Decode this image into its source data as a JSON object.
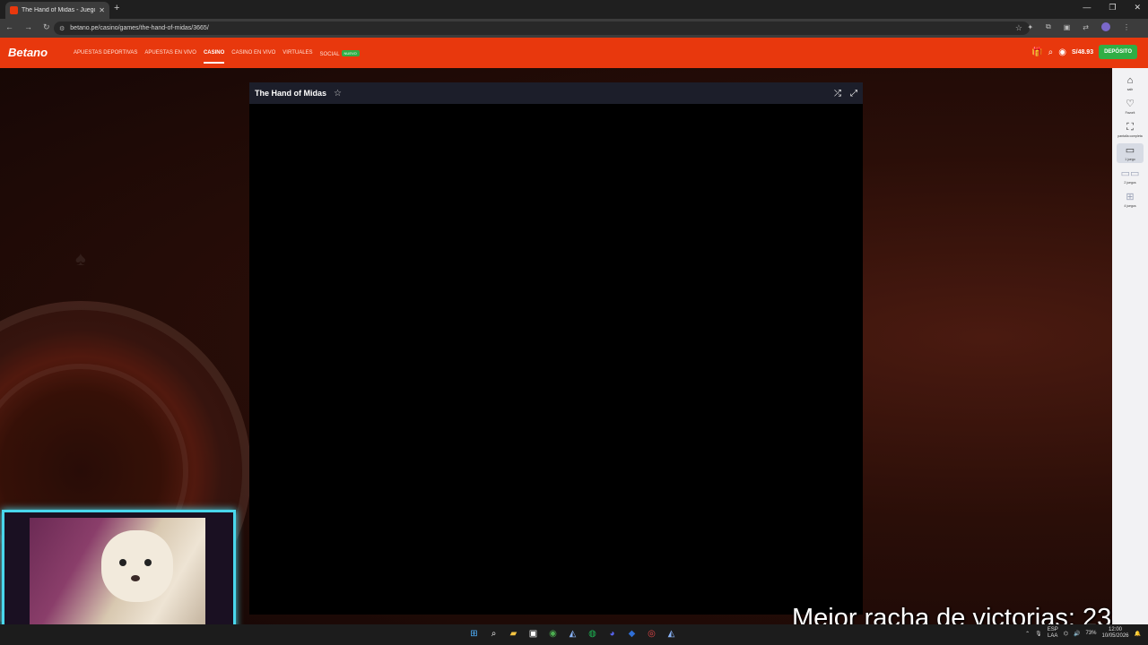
{
  "browser": {
    "tab_title": "The Hand of Midas - Juego onl...",
    "url": "betano.pe/casino/games/the-hand-of-midas/3665/"
  },
  "site": {
    "logo": "Betano",
    "nav": [
      {
        "label": "Apuestas deportivas"
      },
      {
        "label": "Apuestas en vivo"
      },
      {
        "label": "Casino"
      },
      {
        "label": "Casino en vivo"
      },
      {
        "label": "Virtuales"
      },
      {
        "label": "Social"
      }
    ],
    "new_badge": "NUEVO",
    "balance": "S/48.93",
    "deposit_label": "DEPÓSITO"
  },
  "game": {
    "title": "The Hand of Midas"
  },
  "sidebar": {
    "items": [
      {
        "label": "salir"
      },
      {
        "label": "Favorit"
      },
      {
        "label": "pantalla completa"
      },
      {
        "label": "1 juego"
      },
      {
        "label": "2 juegos"
      },
      {
        "label": "4 juegos"
      }
    ]
  },
  "overlay": {
    "streak_text": "Mejor racha de victorias: 23"
  },
  "taskbar": {
    "lang_top": "ESP",
    "lang_bottom": "LAA",
    "battery": "73%",
    "time": "12:00",
    "date": "10/05/2026"
  },
  "colors": {
    "brand": "#e8380d",
    "deposit": "#2fae45",
    "webcam_frame": "#49d7ec"
  }
}
